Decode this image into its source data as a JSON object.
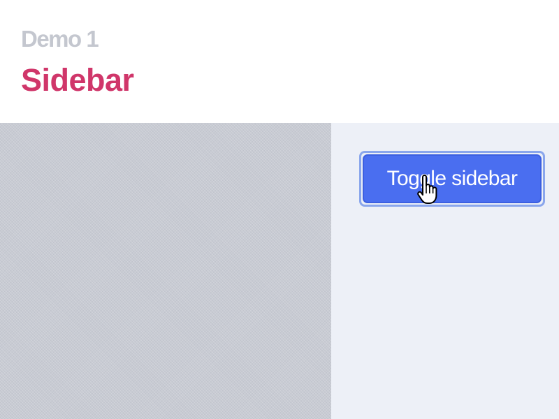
{
  "header": {
    "demo_label": "Demo 1",
    "title": "Sidebar"
  },
  "main": {
    "toggle_button_label": "Toggle sidebar"
  },
  "icons": {
    "cursor": "hand-pointer-icon"
  },
  "colors": {
    "title": "#d0366a",
    "demo_label": "#c4c7cf",
    "button": "#4a6ef0",
    "content_background": "#edf0f7",
    "sidebar": "#c8cbd3"
  }
}
